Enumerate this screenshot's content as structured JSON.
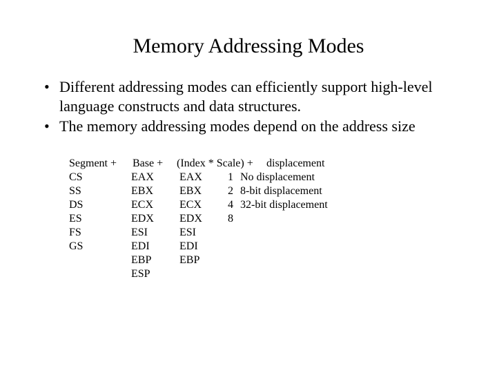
{
  "title": "Memory Addressing Modes",
  "bullets": [
    "Different addressing modes can efficiently support high-level language constructs and data structures.",
    "The memory addressing modes depend on the address size"
  ],
  "table": {
    "header": {
      "segment": "Segment +",
      "base": "Base +",
      "index_scale": "(Index * Scale) +",
      "displacement": "displacement"
    },
    "rows": [
      {
        "seg": "CS",
        "base": "EAX",
        "index": "EAX",
        "scale": "1",
        "disp": "No displacement"
      },
      {
        "seg": "SS",
        "base": "EBX",
        "index": "EBX",
        "scale": "2",
        "disp": "8-bit displacement"
      },
      {
        "seg": "DS",
        "base": "ECX",
        "index": "ECX",
        "scale": "4",
        "disp": "32-bit displacement"
      },
      {
        "seg": "ES",
        "base": "EDX",
        "index": "EDX",
        "scale": "8",
        "disp": ""
      },
      {
        "seg": "FS",
        "base": "ESI",
        "index": "ESI",
        "scale": "",
        "disp": ""
      },
      {
        "seg": "GS",
        "base": "EDI",
        "index": "EDI",
        "scale": "",
        "disp": ""
      },
      {
        "seg": "",
        "base": "EBP",
        "index": "EBP",
        "scale": "",
        "disp": ""
      },
      {
        "seg": "",
        "base": "ESP",
        "index": "",
        "scale": "",
        "disp": ""
      }
    ]
  }
}
